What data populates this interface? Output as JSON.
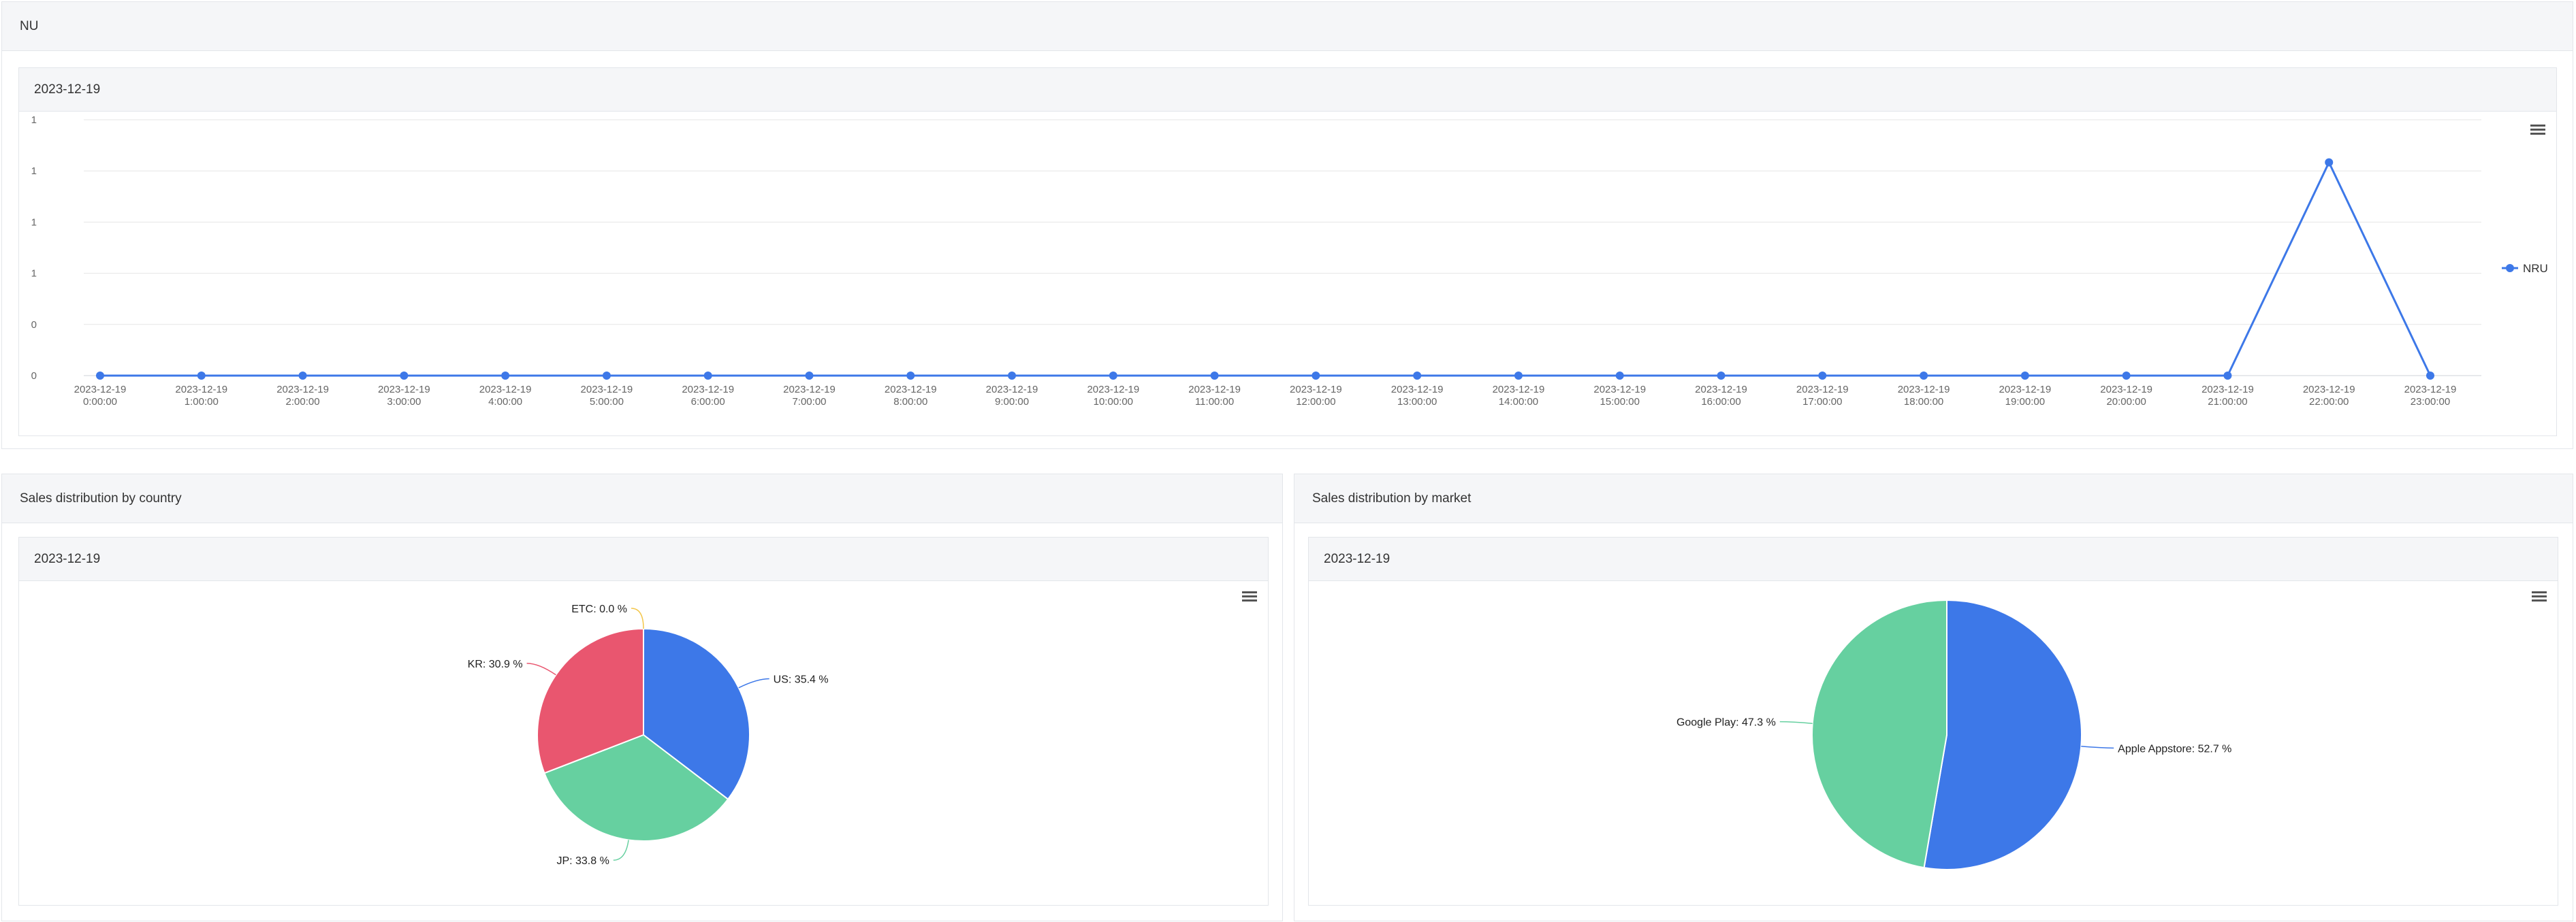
{
  "nu_panel": {
    "title": "NU",
    "card": {
      "date": "2023-12-19",
      "menu_icon": "hamburger-menu-icon",
      "chart_data": {
        "type": "line",
        "y_tick_labels": [
          "1",
          "1",
          "1",
          "1",
          "0",
          "0"
        ],
        "categories": [
          [
            "2023-12-19",
            "0:00:00"
          ],
          [
            "2023-12-19",
            "1:00:00"
          ],
          [
            "2023-12-19",
            "2:00:00"
          ],
          [
            "2023-12-19",
            "3:00:00"
          ],
          [
            "2023-12-19",
            "4:00:00"
          ],
          [
            "2023-12-19",
            "5:00:00"
          ],
          [
            "2023-12-19",
            "6:00:00"
          ],
          [
            "2023-12-19",
            "7:00:00"
          ],
          [
            "2023-12-19",
            "8:00:00"
          ],
          [
            "2023-12-19",
            "9:00:00"
          ],
          [
            "2023-12-19",
            "10:00:00"
          ],
          [
            "2023-12-19",
            "11:00:00"
          ],
          [
            "2023-12-19",
            "12:00:00"
          ],
          [
            "2023-12-19",
            "13:00:00"
          ],
          [
            "2023-12-19",
            "14:00:00"
          ],
          [
            "2023-12-19",
            "15:00:00"
          ],
          [
            "2023-12-19",
            "16:00:00"
          ],
          [
            "2023-12-19",
            "17:00:00"
          ],
          [
            "2023-12-19",
            "18:00:00"
          ],
          [
            "2023-12-19",
            "19:00:00"
          ],
          [
            "2023-12-19",
            "20:00:00"
          ],
          [
            "2023-12-19",
            "21:00:00"
          ],
          [
            "2023-12-19",
            "22:00:00"
          ],
          [
            "2023-12-19",
            "23:00:00"
          ]
        ],
        "ylim": [
          0,
          1.2
        ],
        "series": [
          {
            "name": "NRU",
            "color": "#3d78e8",
            "values": [
              0,
              0,
              0,
              0,
              0,
              0,
              0,
              0,
              0,
              0,
              0,
              0,
              0,
              0,
              0,
              0,
              0,
              0,
              0,
              0,
              0,
              0,
              1,
              0
            ]
          }
        ],
        "legend_position": "right",
        "grid": true
      }
    }
  },
  "country_panel": {
    "title": "Sales distribution by country",
    "card": {
      "date": "2023-12-19",
      "menu_icon": "hamburger-menu-icon",
      "chart_data": {
        "type": "pie",
        "slices": [
          {
            "label": "US: 35.4 %",
            "value": 35.4,
            "color": "#3d78e8"
          },
          {
            "label": "JP: 33.8 %",
            "value": 33.8,
            "color": "#66d0a0"
          },
          {
            "label": "KR: 30.9 %",
            "value": 30.9,
            "color": "#e9566f"
          },
          {
            "label": "ETC: 0.0 %",
            "value": 0.0,
            "color": "#f3c64a"
          }
        ]
      }
    }
  },
  "market_panel": {
    "title": "Sales distribution by market",
    "card": {
      "date": "2023-12-19",
      "menu_icon": "hamburger-menu-icon",
      "chart_data": {
        "type": "pie",
        "slices": [
          {
            "label": "Apple Appstore: 52.7 %",
            "value": 52.7,
            "color": "#3d78e8"
          },
          {
            "label": "Google Play: 47.3 %",
            "value": 47.3,
            "color": "#66d0a0"
          }
        ]
      }
    }
  }
}
